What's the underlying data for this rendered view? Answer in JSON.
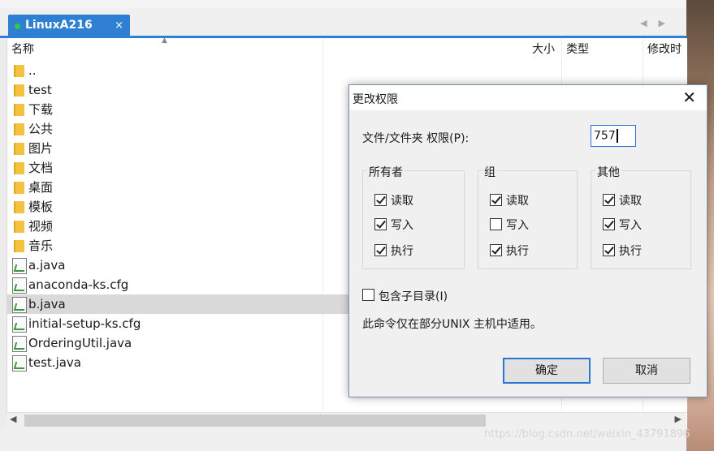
{
  "tab": {
    "title": "LinuxA216",
    "close": "×"
  },
  "columns": {
    "name": "名称",
    "size": "大小",
    "type": "类型",
    "modified": "修改时"
  },
  "files": [
    {
      "name": "..",
      "kind": "folder"
    },
    {
      "name": "test",
      "kind": "folder"
    },
    {
      "name": "下载",
      "kind": "folder"
    },
    {
      "name": "公共",
      "kind": "folder"
    },
    {
      "name": "图片",
      "kind": "folder"
    },
    {
      "name": "文档",
      "kind": "folder"
    },
    {
      "name": "桌面",
      "kind": "folder"
    },
    {
      "name": "模板",
      "kind": "folder"
    },
    {
      "name": "视频",
      "kind": "folder"
    },
    {
      "name": "音乐",
      "kind": "folder"
    },
    {
      "name": "a.java",
      "kind": "file"
    },
    {
      "name": "anaconda-ks.cfg",
      "kind": "file"
    },
    {
      "name": "b.java",
      "kind": "file",
      "selected": true
    },
    {
      "name": "initial-setup-ks.cfg",
      "kind": "file"
    },
    {
      "name": "OrderingUtil.java",
      "kind": "file"
    },
    {
      "name": "test.java",
      "kind": "file"
    }
  ],
  "dialog": {
    "title": "更改权限",
    "close": "✕",
    "perm_label": "文件/文件夹 权限(P):",
    "perm_value": "757",
    "groups": [
      {
        "title": "所有者",
        "read": "读取",
        "write": "写入",
        "exec": "执行",
        "r": true,
        "w": true,
        "x": true
      },
      {
        "title": "组",
        "read": "读取",
        "write": "写入",
        "exec": "执行",
        "r": true,
        "w": false,
        "x": true
      },
      {
        "title": "其他",
        "read": "读取",
        "write": "写入",
        "exec": "执行",
        "r": true,
        "w": true,
        "x": true
      }
    ],
    "subdir_label": "包含子目录(I)",
    "subdir_checked": false,
    "note": "此命令仅在部分UNIX 主机中适用。",
    "ok": "确定",
    "cancel": "取消"
  },
  "watermark": "https://blog.csdn.net/weixin_43791896"
}
